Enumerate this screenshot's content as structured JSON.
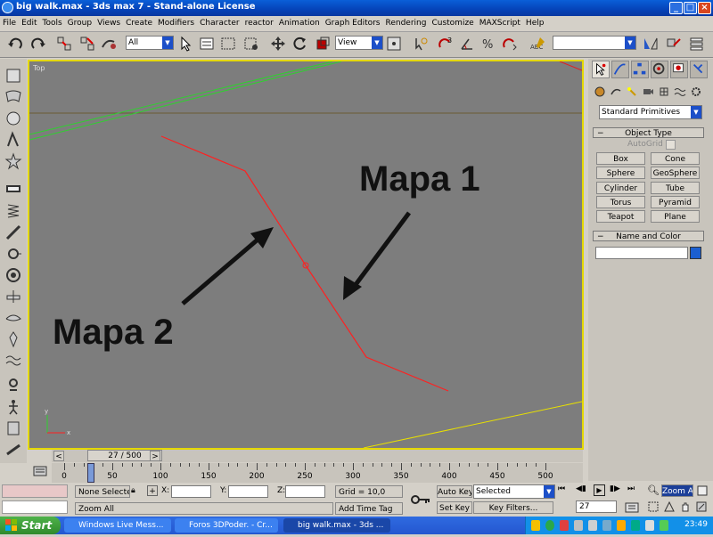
{
  "window": {
    "title": "big walk.max - 3ds max 7 - Stand-alone License"
  },
  "menu": [
    "File",
    "Edit",
    "Tools",
    "Group",
    "Views",
    "Create",
    "Modifiers",
    "Character",
    "reactor",
    "Animation",
    "Graph Editors",
    "Rendering",
    "Customize",
    "MAXScript",
    "Help"
  ],
  "toolbar": {
    "selection_filter": "All",
    "ref_coord": "View",
    "named_selection": ""
  },
  "viewport": {
    "label": "Top",
    "annotation_map1": "Mapa 1",
    "annotation_map2": "Mapa 2"
  },
  "command_panel": {
    "category_dropdown": "Standard Primitives",
    "object_type_header": "Object Type",
    "autogrid_label": "AutoGrid",
    "buttons": [
      "Box",
      "Cone",
      "Sphere",
      "GeoSphere",
      "Cylinder",
      "Tube",
      "Torus",
      "Pyramid",
      "Teapot",
      "Plane"
    ],
    "name_color_header": "Name and Color",
    "name_value": "",
    "object_color": "#1c5fd0"
  },
  "timeline": {
    "slider_text": "27 / 500",
    "current_frame": 27,
    "total_frames": 500,
    "ticks": [
      "0",
      "50",
      "100",
      "150",
      "200",
      "250",
      "300",
      "350",
      "400",
      "450",
      "500"
    ]
  },
  "status": {
    "selection": "None Selecte",
    "x_label": "X:",
    "y_label": "Y:",
    "z_label": "Z:",
    "grid": "Grid = 10,0",
    "prompt": "Zoom All",
    "add_time_tag": "Add Time Tag",
    "auto_key": "Auto Key",
    "set_key": "Set Key",
    "key_mode": "Selected",
    "key_filters": "Key Filters...",
    "frame_field": "27",
    "zoom_all_btn": "Zoom All"
  },
  "taskbar": {
    "start": "Start",
    "tasks": [
      "Windows Live Mess...",
      "Foros 3DPoder. - Cr...",
      "big walk.max - 3ds ..."
    ],
    "clock": "23:49"
  },
  "colors": {
    "viewport_bg": "#7d7d7d",
    "active_border": "#e4d800",
    "spline": "#ff2020"
  }
}
